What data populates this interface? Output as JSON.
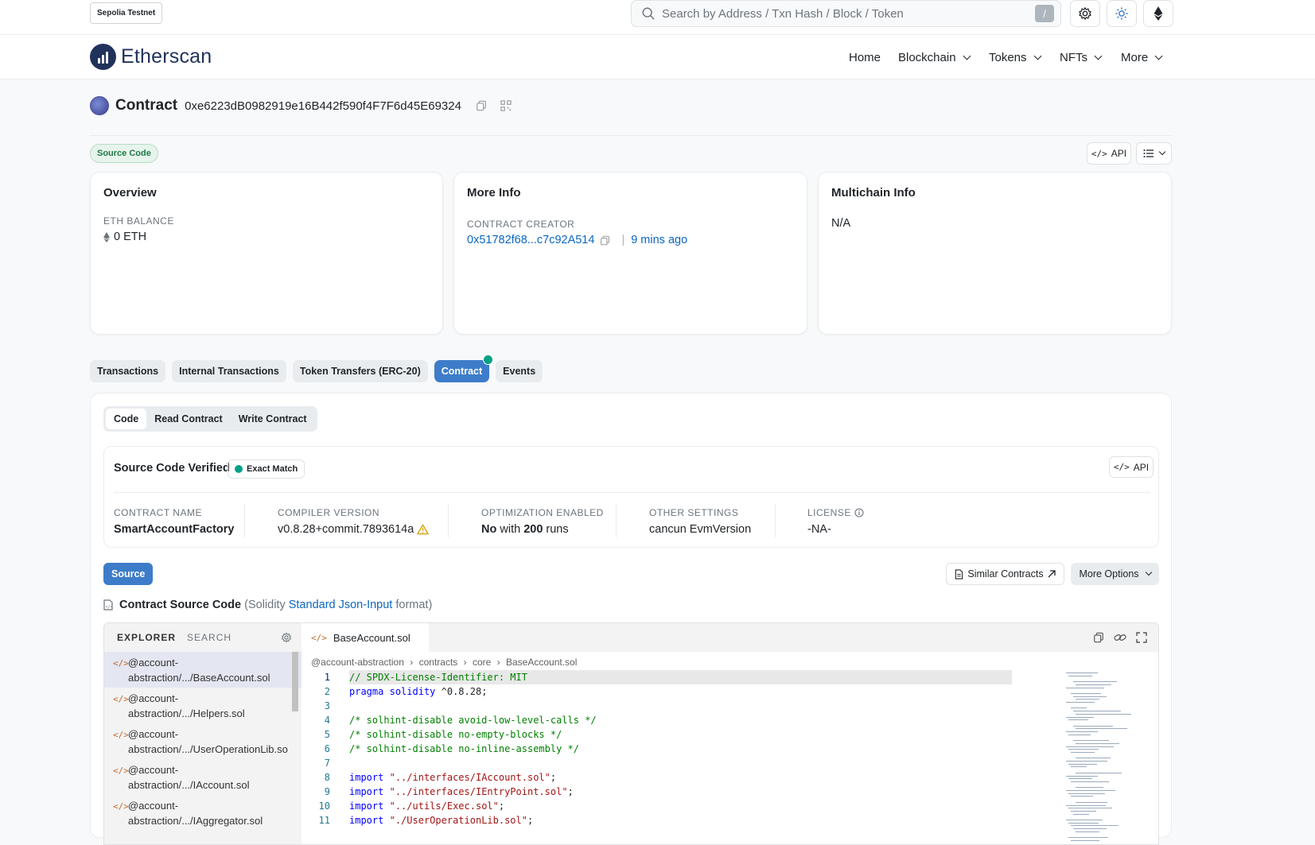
{
  "topbar": {
    "network": "Sepolia Testnet",
    "search_placeholder": "Search by Address / Txn Hash / Block / Token",
    "slash_key": "/"
  },
  "navbar": {
    "logo": "Etherscan",
    "menu": [
      {
        "label": "Home",
        "dropdown": false
      },
      {
        "label": "Blockchain",
        "dropdown": true
      },
      {
        "label": "Tokens",
        "dropdown": true
      },
      {
        "label": "NFTs",
        "dropdown": true
      },
      {
        "label": "More",
        "dropdown": true
      }
    ]
  },
  "header": {
    "title": "Contract",
    "address": "0xe6223dB0982919e16B442f590f4F7F6d45E69324",
    "pill": "Source Code",
    "api": "API"
  },
  "overview": {
    "title": "Overview",
    "balance_label": "ETH BALANCE",
    "balance_value": "0 ETH"
  },
  "more_info": {
    "title": "More Info",
    "creator_label": "CONTRACT CREATOR",
    "creator_address": "0x51782f68...c7c92A514",
    "separator": "|",
    "creator_time": "9 mins ago"
  },
  "multichain": {
    "title": "Multichain Info",
    "value": "N/A"
  },
  "tabs": [
    "Transactions",
    "Internal Transactions",
    "Token Transfers (ERC-20)",
    "Contract",
    "Events"
  ],
  "active_tab": "Contract",
  "subtabs": [
    "Code",
    "Read Contract",
    "Write Contract"
  ],
  "verified": {
    "title": "Source Code Verified",
    "badge": "Exact Match",
    "api": "API",
    "fields": [
      {
        "label": "CONTRACT NAME",
        "value": "SmartAccountFactory"
      },
      {
        "label": "COMPILER VERSION",
        "value": "v0.8.28+commit.7893614a"
      },
      {
        "label": "OPTIMIZATION ENABLED",
        "value_bold": "No",
        "value_mid": " with ",
        "value_bold2": "200",
        "value_end": " runs"
      },
      {
        "label": "OTHER SETTINGS",
        "value": "cancun EvmVersion"
      },
      {
        "label": "LICENSE",
        "value": "-NA-"
      }
    ]
  },
  "source": {
    "button": "Source",
    "similar": "Similar Contracts",
    "more_options": "More Options",
    "heading": "Contract Source Code",
    "heading_pre": "(Solidity ",
    "heading_link": "Standard Json-Input",
    "heading_post": " format)"
  },
  "explorer": {
    "tab_explorer": "EXPLORER",
    "tab_search": "SEARCH",
    "files": [
      {
        "line1": "@account-",
        "line2": "abstraction/.../BaseAccount.sol"
      },
      {
        "line1": "@account-",
        "line2": "abstraction/.../Helpers.sol"
      },
      {
        "line1": "@account-",
        "line2": "abstraction/.../UserOperationLib.so"
      },
      {
        "line1": "@account-",
        "line2": "abstraction/.../IAccount.sol"
      },
      {
        "line1": "@account-",
        "line2": "abstraction/.../IAggregator.sol"
      }
    ]
  },
  "editor": {
    "file_tab": "BaseAccount.sol",
    "breadcrumb": [
      "@account-abstraction",
      "contracts",
      "core",
      "BaseAccount.sol"
    ],
    "lines": [
      {
        "n": "1",
        "parts": [
          {
            "t": "// SPDX-License-Identifier: MIT",
            "c": "com"
          }
        ]
      },
      {
        "n": "2",
        "parts": [
          {
            "t": "pragma",
            "c": "kw"
          },
          {
            "t": " ",
            "c": ""
          },
          {
            "t": "solidity",
            "c": "kw"
          },
          {
            "t": " ^0.8.28;",
            "c": ""
          }
        ]
      },
      {
        "n": "3",
        "parts": []
      },
      {
        "n": "4",
        "parts": [
          {
            "t": "/* solhint-disable avoid-low-level-calls */",
            "c": "com"
          }
        ]
      },
      {
        "n": "5",
        "parts": [
          {
            "t": "/* solhint-disable no-empty-blocks */",
            "c": "com"
          }
        ]
      },
      {
        "n": "6",
        "parts": [
          {
            "t": "/* solhint-disable no-inline-assembly */",
            "c": "com"
          }
        ]
      },
      {
        "n": "7",
        "parts": []
      },
      {
        "n": "8",
        "parts": [
          {
            "t": "import",
            "c": "kw"
          },
          {
            "t": " ",
            "c": ""
          },
          {
            "t": "\"../interfaces/IAccount.sol\"",
            "c": "str"
          },
          {
            "t": ";",
            "c": ""
          }
        ]
      },
      {
        "n": "9",
        "parts": [
          {
            "t": "import",
            "c": "kw"
          },
          {
            "t": " ",
            "c": ""
          },
          {
            "t": "\"../interfaces/IEntryPoint.sol\"",
            "c": "str"
          },
          {
            "t": ";",
            "c": ""
          }
        ]
      },
      {
        "n": "10",
        "parts": [
          {
            "t": "import",
            "c": "kw"
          },
          {
            "t": " ",
            "c": ""
          },
          {
            "t": "\"../utils/Exec.sol\"",
            "c": "str"
          },
          {
            "t": ";",
            "c": ""
          }
        ]
      },
      {
        "n": "11",
        "parts": [
          {
            "t": "import",
            "c": "kw"
          },
          {
            "t": " ",
            "c": ""
          },
          {
            "t": "\"./UserOperationLib.sol\"",
            "c": "str"
          },
          {
            "t": ";",
            "c": ""
          }
        ]
      }
    ]
  },
  "colors": {
    "primary": "#3d7cc9",
    "link": "#0b66c2",
    "success": "#00a186"
  }
}
